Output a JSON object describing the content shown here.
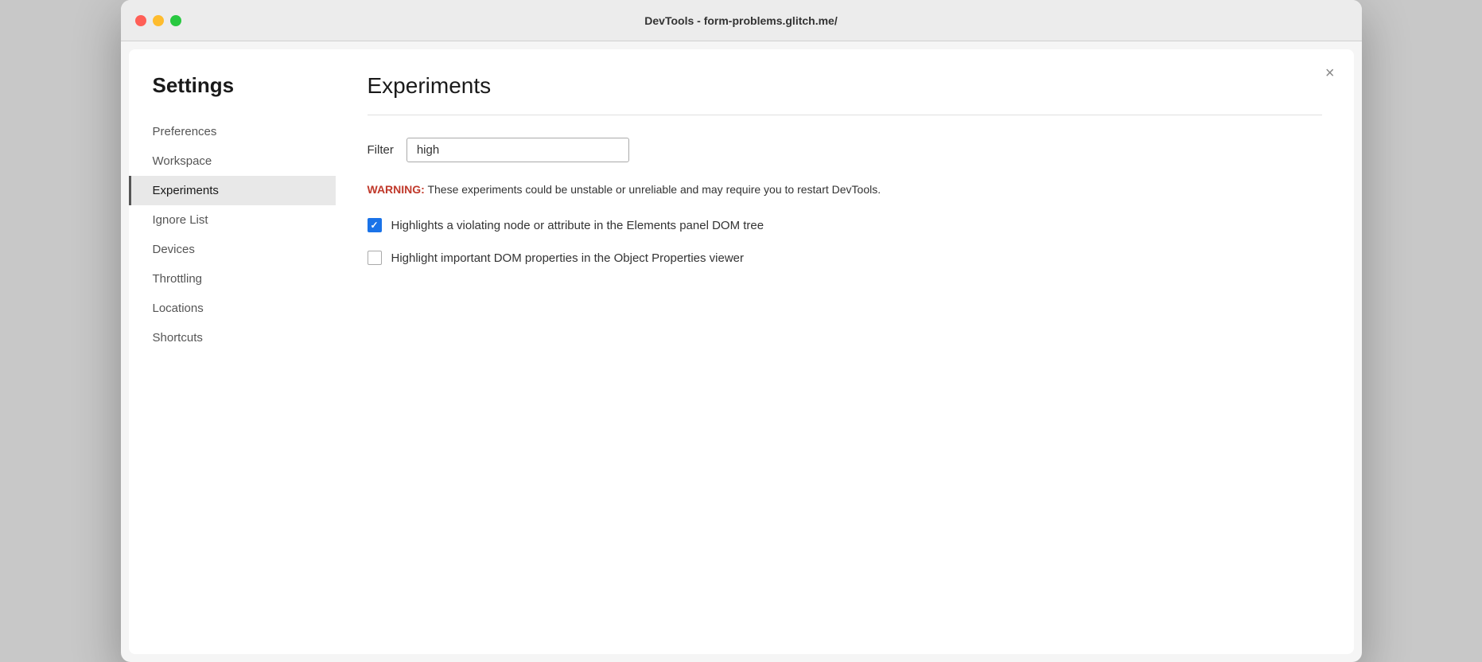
{
  "titlebar": {
    "title": "DevTools - form-problems.glitch.me/"
  },
  "sidebar": {
    "heading": "Settings",
    "items": [
      {
        "id": "preferences",
        "label": "Preferences",
        "active": false
      },
      {
        "id": "workspace",
        "label": "Workspace",
        "active": false
      },
      {
        "id": "experiments",
        "label": "Experiments",
        "active": true
      },
      {
        "id": "ignore-list",
        "label": "Ignore List",
        "active": false
      },
      {
        "id": "devices",
        "label": "Devices",
        "active": false
      },
      {
        "id": "throttling",
        "label": "Throttling",
        "active": false
      },
      {
        "id": "locations",
        "label": "Locations",
        "active": false
      },
      {
        "id": "shortcuts",
        "label": "Shortcuts",
        "active": false
      }
    ]
  },
  "main": {
    "title": "Experiments",
    "close_label": "×",
    "filter": {
      "label": "Filter",
      "value": "high",
      "placeholder": ""
    },
    "warning": {
      "prefix": "WARNING:",
      "text": " These experiments could be unstable or unreliable and may require you to restart DevTools."
    },
    "experiments": [
      {
        "id": "exp1",
        "label": "Highlights a violating node or attribute in the Elements panel DOM tree",
        "checked": true
      },
      {
        "id": "exp2",
        "label": "Highlight important DOM properties in the Object Properties viewer",
        "checked": false
      }
    ]
  },
  "icons": {
    "close": "✕",
    "check": "✓"
  }
}
